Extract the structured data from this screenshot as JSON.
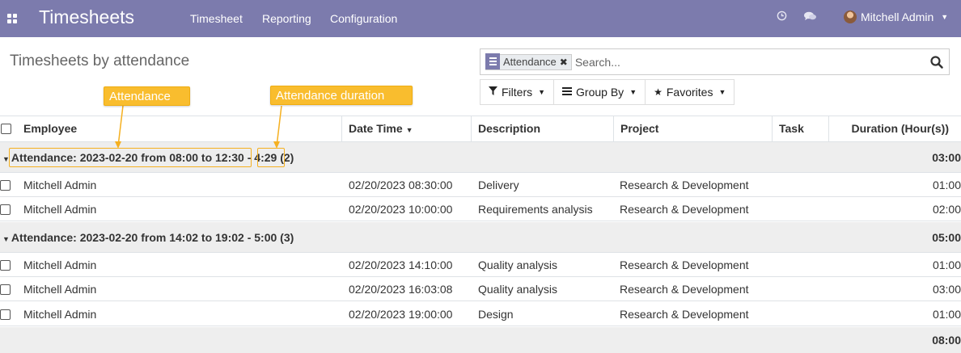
{
  "navbar": {
    "app_title": "Timesheets",
    "menu": [
      "Timesheet",
      "Reporting",
      "Configuration"
    ],
    "user_name": "Mitchell Admin",
    "bg_color": "#7c7bad",
    "icons": [
      "apps-icon",
      "clock-icon",
      "chat-icon",
      "avatar",
      "caret-down-icon"
    ]
  },
  "control_panel": {
    "breadcrumb": "Timesheets by attendance",
    "search": {
      "facet_label": "Attendance",
      "placeholder": "Search..."
    },
    "filters_label": "Filters",
    "groupby_label": "Group By",
    "favorites_label": "Favorites"
  },
  "table": {
    "columns": [
      "Employee",
      "Date Time",
      "Description",
      "Project",
      "Task",
      "Duration (Hour(s))"
    ],
    "groups": [
      {
        "label_prefix": "Attendance: ",
        "label_range": "2023-02-20 from 08:00 to 12:30",
        "label_sep": " - ",
        "label_duration": "4:29",
        "label_count": " (2)",
        "total": "03:00",
        "rows": [
          {
            "employee": "Mitchell Admin",
            "datetime": "02/20/2023 08:30:00",
            "description": "Delivery",
            "project": "Research & Development",
            "task": "",
            "duration": "01:00"
          },
          {
            "employee": "Mitchell Admin",
            "datetime": "02/20/2023 10:00:00",
            "description": "Requirements analysis",
            "project": "Research & Development",
            "task": "",
            "duration": "02:00"
          }
        ]
      },
      {
        "label": "Attendance: 2023-02-20 from 14:02 to 19:02 - 5:00 (3)",
        "total": "05:00",
        "rows": [
          {
            "employee": "Mitchell Admin",
            "datetime": "02/20/2023 14:10:00",
            "description": "Quality analysis",
            "project": "Research & Development",
            "task": "",
            "duration": "01:00"
          },
          {
            "employee": "Mitchell Admin",
            "datetime": "02/20/2023 16:03:08",
            "description": "Quality analysis",
            "project": "Research & Development",
            "task": "",
            "duration": "03:00"
          },
          {
            "employee": "Mitchell Admin",
            "datetime": "02/20/2023 19:00:00",
            "description": "Design",
            "project": "Research & Development",
            "task": "",
            "duration": "01:00"
          }
        ]
      }
    ],
    "grand_total": "08:00"
  },
  "annotations": {
    "attendance": "Attendance",
    "attendance_duration": "Attendance duration",
    "color": "#f9bd2e"
  }
}
